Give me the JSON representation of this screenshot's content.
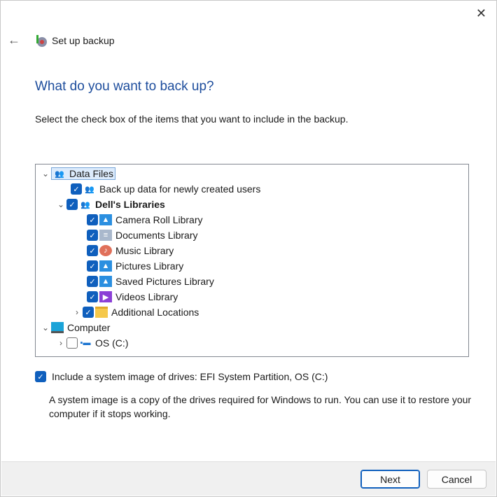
{
  "window": {
    "title": "Set up backup",
    "close_icon": "close-icon",
    "back_icon": "back-arrow-icon"
  },
  "heading": "What do you want to back up?",
  "instruction": "Select the check box of the items that you want to include in the backup.",
  "tree": [
    {
      "label": "Data Files",
      "checked": null,
      "icon": "user-files-icon",
      "expander": "expanded"
    },
    {
      "label": "Back up data for newly created users",
      "checked": true,
      "icon": "user-files-icon",
      "expander": null
    },
    {
      "label": "Dell's Libraries",
      "checked": true,
      "icon": "user-files-icon",
      "expander": "expanded"
    },
    {
      "label": "Camera Roll Library",
      "checked": true,
      "icon": "pictures-icon",
      "expander": null
    },
    {
      "label": "Documents Library",
      "checked": true,
      "icon": "documents-icon",
      "expander": null
    },
    {
      "label": "Music Library",
      "checked": true,
      "icon": "music-icon",
      "expander": null
    },
    {
      "label": "Pictures Library",
      "checked": true,
      "icon": "pictures-icon",
      "expander": null
    },
    {
      "label": "Saved Pictures Library",
      "checked": true,
      "icon": "pictures-icon",
      "expander": null
    },
    {
      "label": "Videos Library",
      "checked": true,
      "icon": "videos-icon",
      "expander": null
    },
    {
      "label": "Additional Locations",
      "checked": true,
      "icon": "folder-icon",
      "expander": "collapsed"
    },
    {
      "label": "Computer",
      "checked": null,
      "icon": "computer-icon",
      "expander": "expanded"
    },
    {
      "label": "OS (C:)",
      "checked": false,
      "icon": "drive-icon",
      "expander": "collapsed"
    }
  ],
  "system_image": {
    "checked": true,
    "label": "Include a system image of drives: EFI System Partition, OS (C:)",
    "description": "A system image is a copy of the drives required for Windows to run. You can use it to restore your computer if it stops working."
  },
  "buttons": {
    "next": "Next",
    "cancel": "Cancel"
  }
}
